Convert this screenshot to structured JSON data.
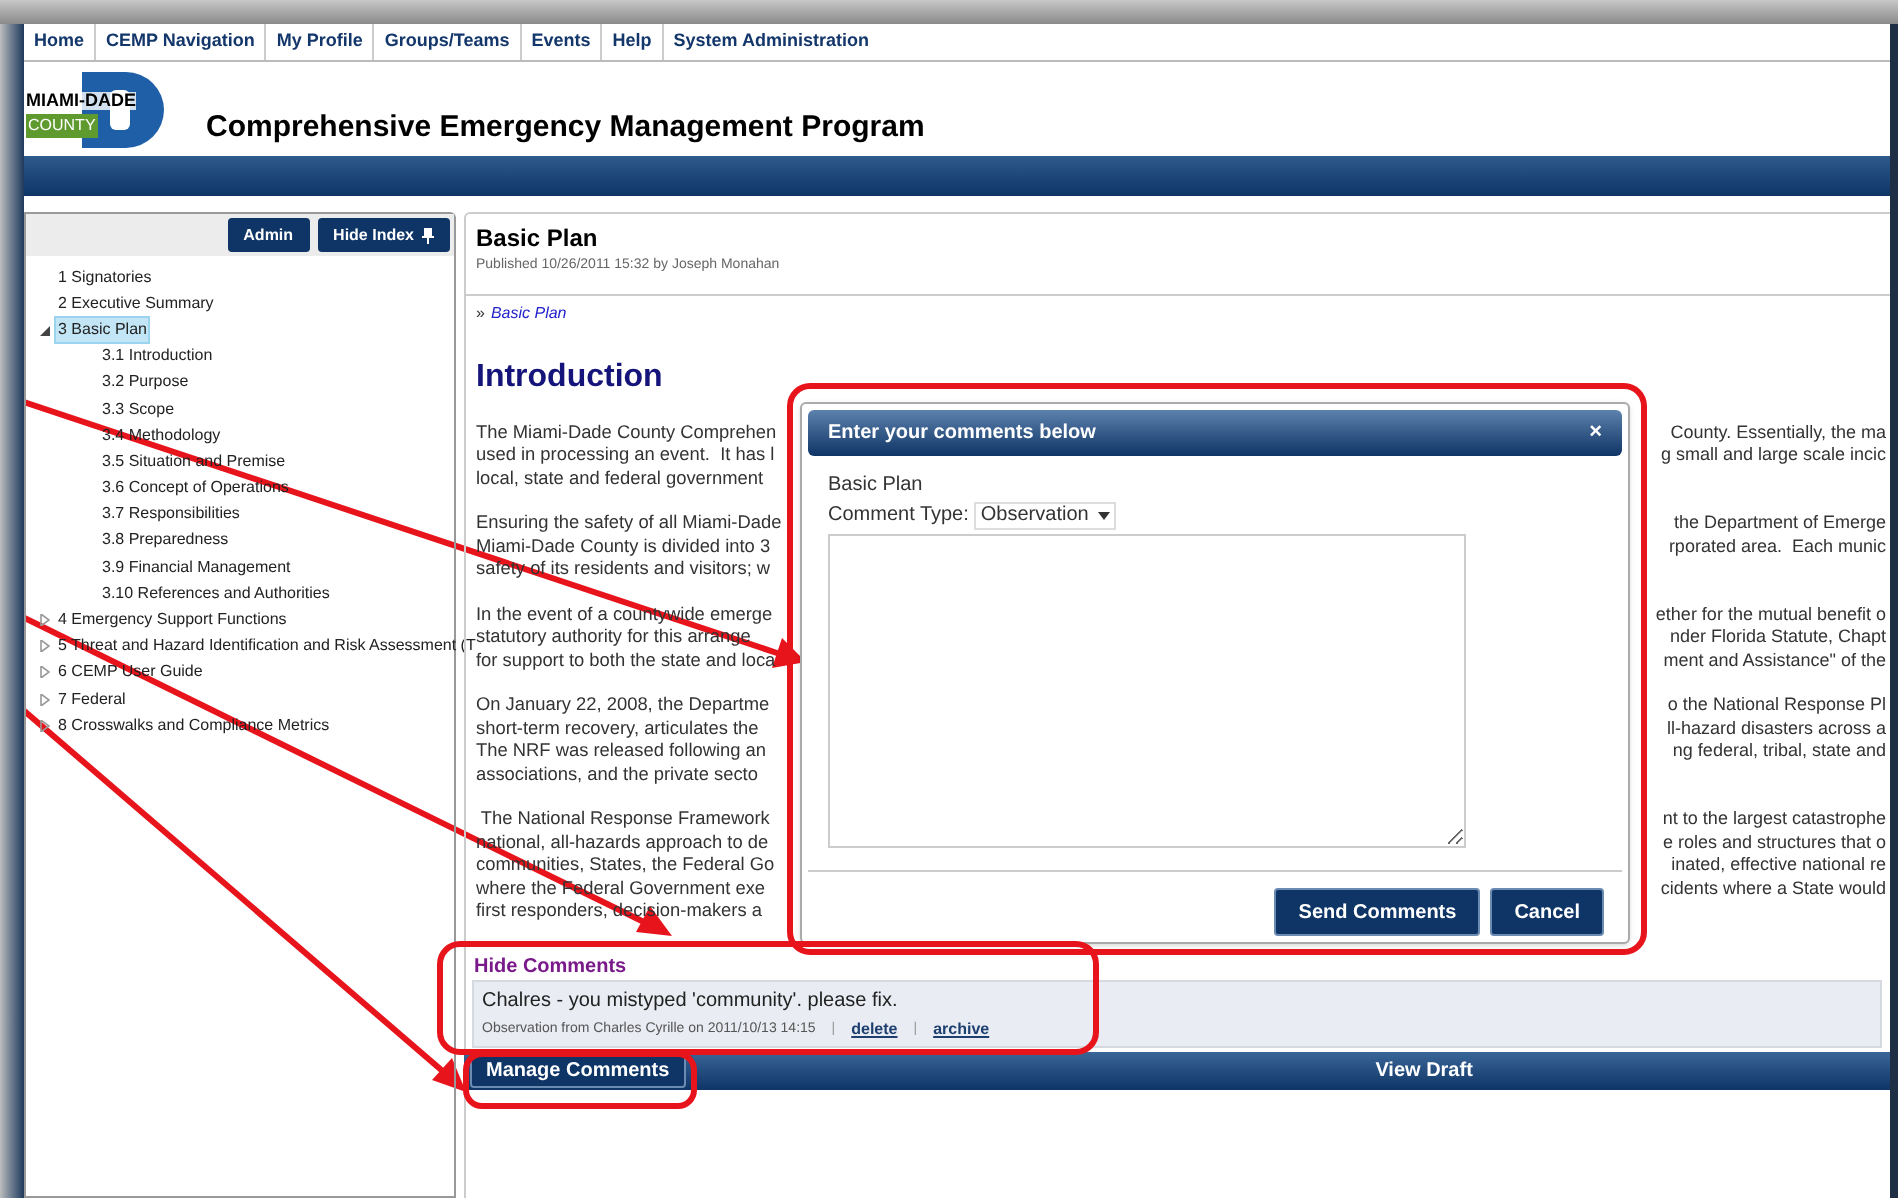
{
  "nav": [
    "Home",
    "CEMP Navigation",
    "My Profile",
    "Groups/Teams",
    "Events",
    "Help",
    "System Administration"
  ],
  "logo": {
    "top": "MIAMI-DADE",
    "bottom": "COUNTY"
  },
  "app_title": "Comprehensive Emergency Management Program",
  "index": {
    "buttons": [
      "Admin",
      "Hide Index"
    ],
    "items": [
      {
        "label": "1 Signatories",
        "selected": false
      },
      {
        "label": "2 Executive Summary",
        "selected": false
      },
      {
        "label": "3 Basic Plan",
        "selected": true,
        "expanded": true,
        "children": [
          {
            "label": "3.1 Introduction",
            "selected": false
          },
          {
            "label": "3.2 Purpose",
            "selected": false
          },
          {
            "label": "3.3 Scope",
            "selected": false
          },
          {
            "label": "3.4 Methodology",
            "selected": false
          },
          {
            "label": "3.5 Situation and Premise",
            "selected": false
          },
          {
            "label": "3.6 Concept of Operations",
            "selected": false
          },
          {
            "label": "3.7 Responsibilities",
            "selected": false
          },
          {
            "label": "3.8 Preparedness",
            "selected": false
          },
          {
            "label": "3.9 Financial Management",
            "selected": false
          },
          {
            "label": "3.10 References and Authorities",
            "selected": false
          }
        ]
      },
      {
        "label": "4 Emergency Support Functions",
        "selected": false,
        "expanded": false
      },
      {
        "label": "5 Threat and Hazard Identification and Risk Assessment (T",
        "selected": false,
        "expanded": false
      },
      {
        "label": "6 CEMP User Guide",
        "selected": false,
        "expanded": false
      },
      {
        "label": "7 Federal",
        "selected": false,
        "expanded": false
      },
      {
        "label": "8 Crosswalks and Compliance Metrics",
        "selected": false,
        "expanded": false
      }
    ]
  },
  "document": {
    "title": "Basic Plan",
    "published": "Published 10/26/2011 15:32 by Joseph Monahan",
    "breadcrumb_mark": "»",
    "breadcrumb": "Basic Plan",
    "heading": "Introduction",
    "paragraphs": [
      [
        {
          "left": "The Miami-Dade County Comprehen",
          "right": "County. Essentially, the ma"
        },
        {
          "left": "used in processing an event.  It has l",
          "right": "g small and large scale incic"
        },
        {
          "left": "local, state and federal government"
        }
      ],
      [
        {
          "left": "Ensuring the safety of all Miami-Dade",
          "right": "the Department of Emerge"
        },
        {
          "left": "Miami-Dade County is divided into 3",
          "right": "rporated area.  Each munic"
        },
        {
          "left": "safety of its residents and visitors; w"
        }
      ],
      [
        {
          "left": "In the event of a countywide emerge",
          "right": "ether for the mutual benefit o"
        },
        {
          "left": "statutory authority for this arrange",
          "right": "nder Florida Statute, Chapt"
        },
        {
          "left": "for support to both the state and loca",
          "right": "ment and Assistance\" of the"
        }
      ],
      [
        {
          "left": "On January 22, 2008, the Departme",
          "right": "o the National Response Pl"
        },
        {
          "left": "short-term recovery, articulates the",
          "right": "ll-hazard disasters across a"
        },
        {
          "left": "The NRF was released following an",
          "right": "ng federal, tribal, state and"
        },
        {
          "left": "associations, and the private secto"
        }
      ],
      [
        {
          "left": " The National Response Framework",
          "right": "nt to the largest catastrophe"
        },
        {
          "left": "national, all-hazards approach to de",
          "right": "e roles and structures that o"
        },
        {
          "left": "communities, States, the Federal Go",
          "right": "inated, effective national re"
        },
        {
          "left": "where the Federal Government exe",
          "right": "cidents where a State would"
        },
        {
          "left": "first responders, decision-makers a"
        }
      ]
    ]
  },
  "dialog": {
    "title": "Enter your comments below",
    "close": "×",
    "document": "Basic Plan",
    "comment_type_label": "Comment Type:",
    "comment_type": "Observation",
    "buttons": [
      "Send Comments",
      "Cancel"
    ]
  },
  "comments": {
    "toggle": "Hide Comments",
    "items": [
      {
        "text": "Chalres - you mistyped 'community'. please fix.",
        "meta": "Observation from Charles Cyrille on 2011/10/13 14:15",
        "separator": "|",
        "actions": [
          "delete",
          "archive"
        ]
      }
    ]
  },
  "bottom_bar": {
    "button": "Manage Comments",
    "label": "View Draft"
  }
}
